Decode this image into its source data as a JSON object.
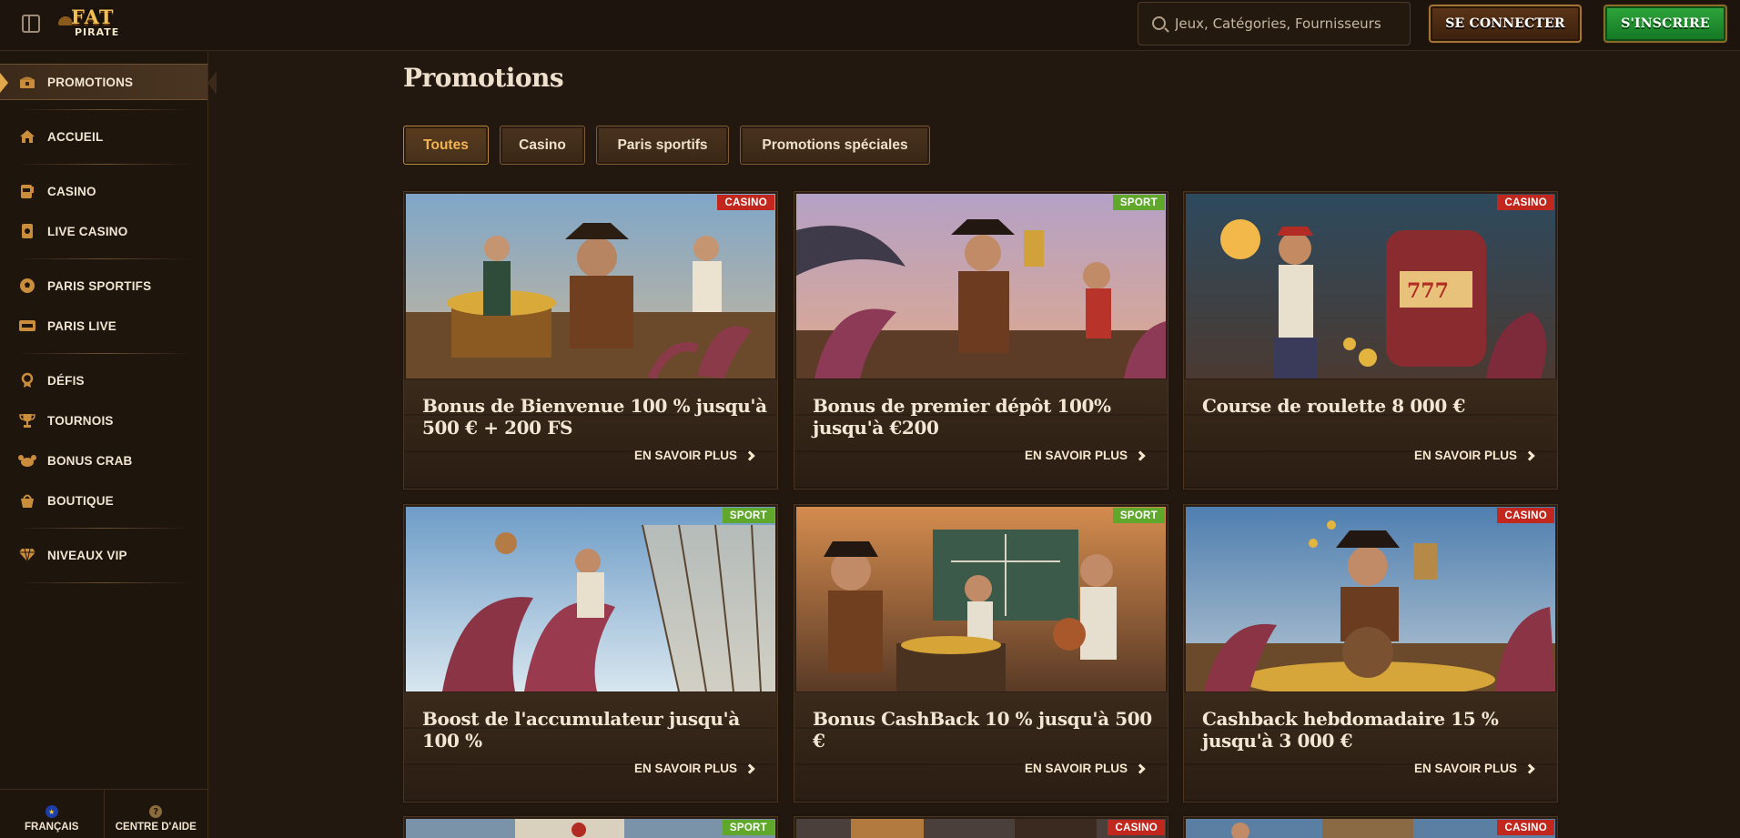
{
  "header": {
    "logo_top": "FAT",
    "logo_bottom": "PIRATE",
    "search_placeholder": "Jeux, Catégories, Fournisseurs",
    "login_label": "SE CONNECTER",
    "signup_label": "S'INSCRIRE"
  },
  "sidebar": {
    "items": [
      {
        "label": "PROMOTIONS",
        "icon": "treasure-chest-icon",
        "active": true
      },
      {
        "label": "ACCUEIL",
        "icon": "home-icon"
      },
      {
        "label": "CASINO",
        "icon": "slot-machine-icon"
      },
      {
        "label": "LIVE CASINO",
        "icon": "live-cards-icon"
      },
      {
        "label": "PARIS SPORTIFS",
        "icon": "soccer-ball-icon"
      },
      {
        "label": "PARIS LIVE",
        "icon": "live-badge-icon"
      },
      {
        "label": "DÉFIS",
        "icon": "medal-icon"
      },
      {
        "label": "TOURNOIS",
        "icon": "trophy-icon"
      },
      {
        "label": "BONUS CRAB",
        "icon": "crab-icon"
      },
      {
        "label": "BOUTIQUE",
        "icon": "shopping-basket-icon"
      },
      {
        "label": "NIVEAUX VIP",
        "icon": "diamond-icon"
      }
    ],
    "footer": {
      "language_label": "FRANÇAIS",
      "help_label": "CENTRE D'AIDE"
    }
  },
  "main": {
    "title": "Promotions",
    "tabs": [
      {
        "label": "Toutes",
        "active": true
      },
      {
        "label": "Casino"
      },
      {
        "label": "Paris sportifs"
      },
      {
        "label": "Promotions spéciales"
      }
    ],
    "cards": [
      {
        "badge": "CASINO",
        "title": "Bonus de Bienvenue 100 % jusqu'à 500 € + 200 FS",
        "link": "EN SAVOIR PLUS"
      },
      {
        "badge": "SPORT",
        "title": "Bonus de premier dépôt 100% jusqu'à €200",
        "link": "EN SAVOIR PLUS"
      },
      {
        "badge": "CASINO",
        "title": "Course de roulette 8 000 €",
        "link": "EN SAVOIR PLUS"
      },
      {
        "badge": "SPORT",
        "title": "Boost de l'accumulateur jusqu'à 100 %",
        "link": "EN SAVOIR PLUS"
      },
      {
        "badge": "SPORT",
        "title": "Bonus CashBack 10 % jusqu'à 500 €",
        "link": "EN SAVOIR PLUS"
      },
      {
        "badge": "CASINO",
        "title": "Cashback hebdomadaire 15 % jusqu'à 3 000 €",
        "link": "EN SAVOIR PLUS"
      },
      {
        "badge": "SPORT"
      },
      {
        "badge": "CASINO"
      },
      {
        "badge": "CASINO"
      }
    ]
  },
  "colors": {
    "background": "#221810",
    "accent": "#f3b451",
    "casino_badge": "#c2271e",
    "sport_badge": "#5fa82c",
    "signup_green": "#2fa63c"
  }
}
